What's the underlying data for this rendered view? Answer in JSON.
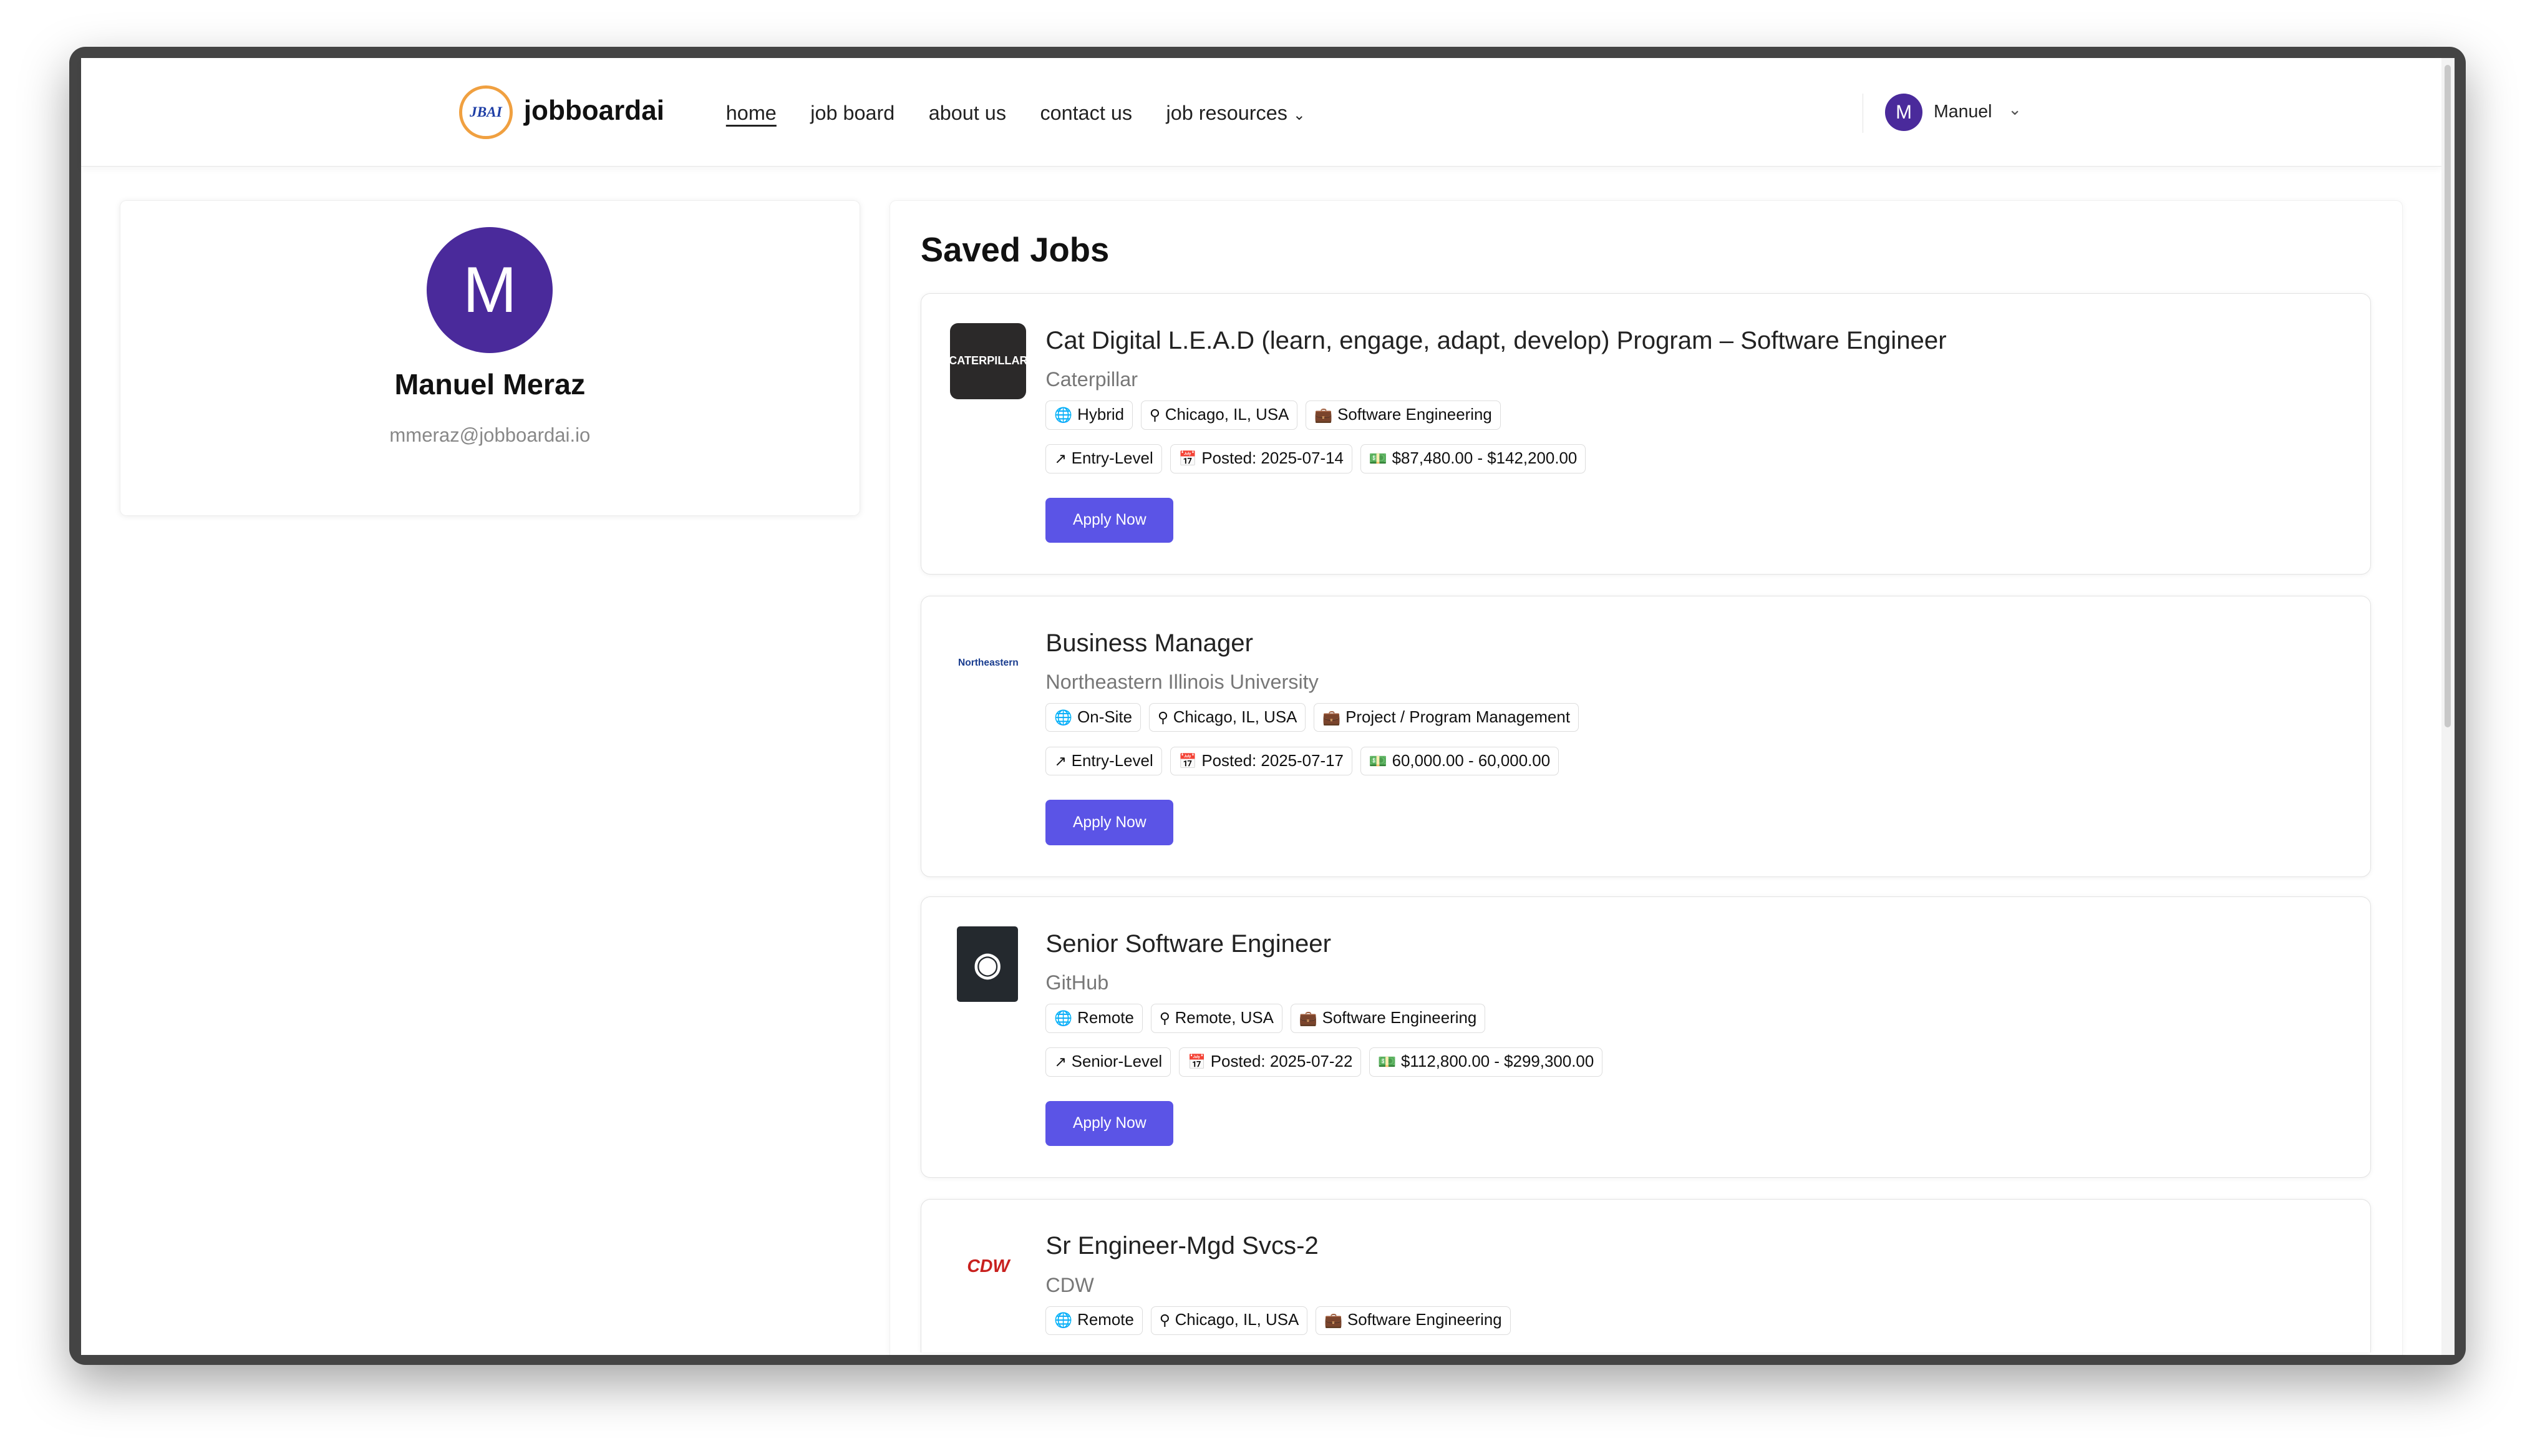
{
  "header": {
    "logo_text": "JBAI",
    "brand": "jobboardai",
    "nav": [
      "home",
      "job board",
      "about us",
      "contact us",
      "job resources"
    ],
    "user_initial": "M",
    "user_name": "Manuel"
  },
  "profile": {
    "initial": "M",
    "name": "Manuel Meraz",
    "email": "mmeraz@jobboardai.io"
  },
  "main": {
    "title": "Saved Jobs",
    "apply_label": "Apply Now"
  },
  "colors": {
    "accent": "#5b54e6",
    "avatar": "#4a2a9b"
  },
  "jobs": [
    {
      "title": "Cat Digital L.E.A.D (learn, engage, adapt, develop) Program – Software Engineer",
      "company": "Caterpillar",
      "logo": "CATERPILLAR",
      "work_mode": "Hybrid",
      "location": "Chicago, IL, USA",
      "category": "Software Engineering",
      "level": "Entry-Level",
      "posted": "Posted: 2025-07-14",
      "salary": "$87,480.00 - $142,200.00"
    },
    {
      "title": "Business Manager",
      "company": "Northeastern Illinois University",
      "logo": "Northeastern",
      "work_mode": "On-Site",
      "location": "Chicago, IL, USA",
      "category": "Project / Program Management",
      "level": "Entry-Level",
      "posted": "Posted: 2025-07-17",
      "salary": "60,000.00 - 60,000.00"
    },
    {
      "title": "Senior Software Engineer",
      "company": "GitHub",
      "logo": "GitHub",
      "work_mode": "Remote",
      "location": "Remote, USA",
      "category": "Software Engineering",
      "level": "Senior-Level",
      "posted": "Posted: 2025-07-22",
      "salary": "$112,800.00 - $299,300.00"
    },
    {
      "title": "Sr Engineer-Mgd Svcs-2",
      "company": "CDW",
      "logo": "CDW",
      "work_mode": "Remote",
      "location": "Chicago, IL, USA",
      "category": "Software Engineering"
    }
  ]
}
